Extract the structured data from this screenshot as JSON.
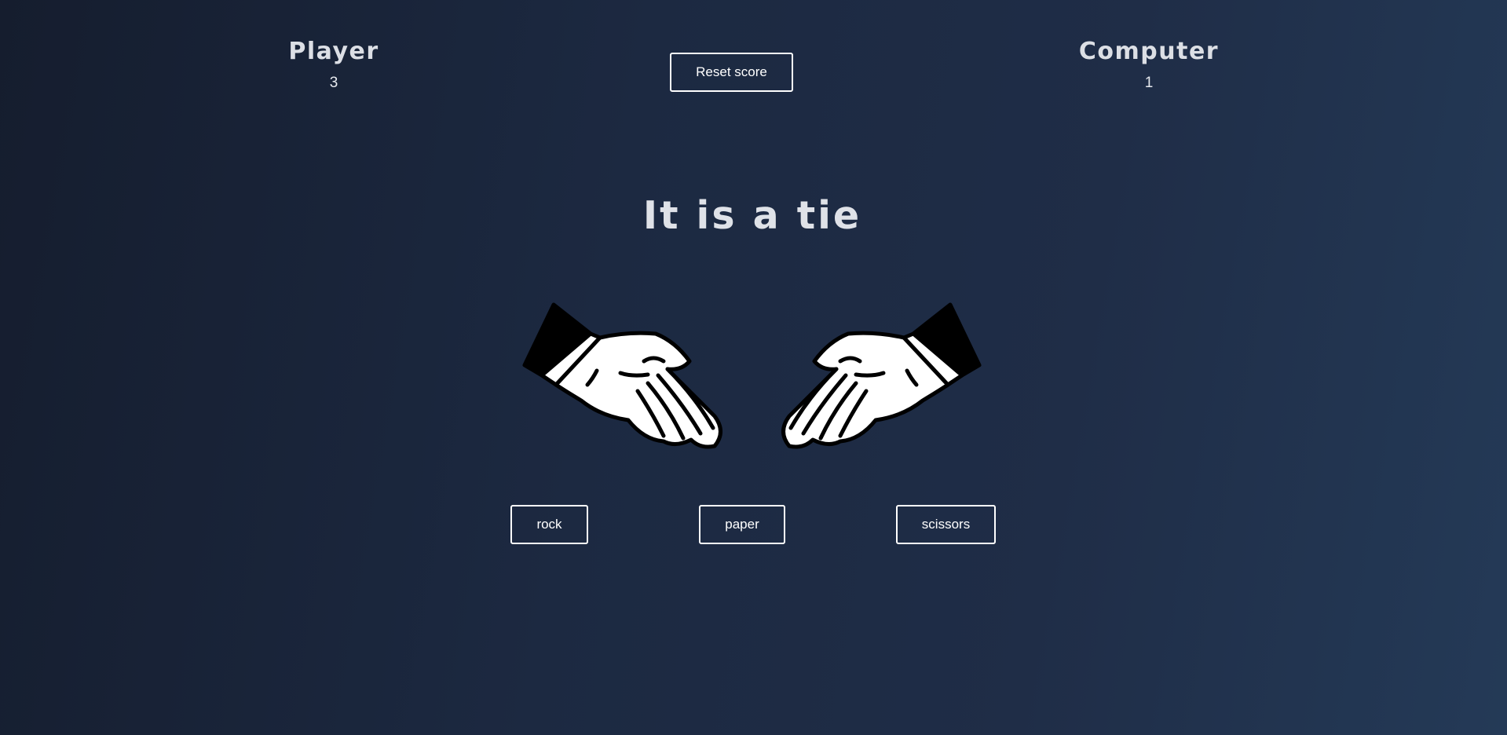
{
  "scoreboard": {
    "player": {
      "label": "Player",
      "score": "3"
    },
    "computer": {
      "label": "Computer",
      "score": "1"
    },
    "reset_label": "Reset score"
  },
  "result": {
    "message": "It is a tie",
    "player_hand": "hand-paper-icon",
    "computer_hand": "hand-paper-icon"
  },
  "choices": [
    {
      "label": "rock"
    },
    {
      "label": "paper"
    },
    {
      "label": "scissors"
    }
  ],
  "colors": {
    "background_start": "#151d2e",
    "background_end": "#243a57",
    "text": "#dcdfe5",
    "button_border": "#ffffff"
  }
}
